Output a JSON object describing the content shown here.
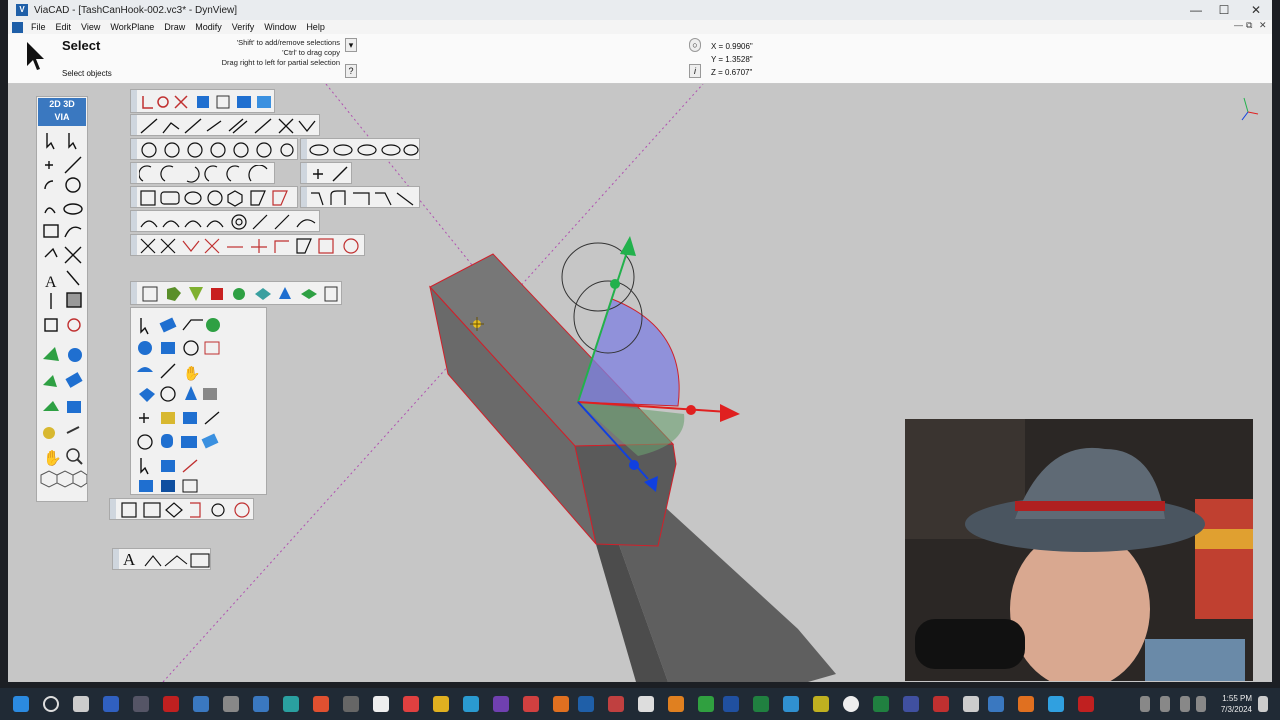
{
  "window": {
    "title": "ViaCAD - [TashCanHook-002.vc3* - DynView]",
    "minimize": "—",
    "maximize": "☐",
    "close": "✕"
  },
  "menu": {
    "items": [
      "File",
      "Edit",
      "View",
      "WorkPlane",
      "Draw",
      "Modify",
      "Verify",
      "Window",
      "Help"
    ],
    "mdi_controls": [
      "—",
      "⧉",
      "✕"
    ]
  },
  "prompt": {
    "command": "Select",
    "subprompt": "Select objects",
    "hints": [
      "'Shift' to add/remove selections",
      "'Ctrl' to drag copy",
      "Drag right to left for partial selection"
    ],
    "help_btn": "?",
    "filter_btn": "▾",
    "info_btn": "i"
  },
  "coords": {
    "x": "X = 0.9906\"",
    "y": "Y = 1.3528\"",
    "z": "Z = 0.6707\""
  },
  "palette_header": {
    "label_2d": "2D",
    "label_3d": "3D",
    "label_via": "VIA"
  },
  "text_palette": {
    "label": "A"
  },
  "taskbar": {
    "time": "1:55 PM",
    "date": "7/3/2024"
  },
  "colors": {
    "viewport_bg": "#c6c6c6",
    "model_face": "#6e6e6e",
    "edge_red": "#d0202a",
    "axis_green": "#22b14c",
    "axis_red": "#e02020",
    "axis_blue": "#1040e0"
  }
}
